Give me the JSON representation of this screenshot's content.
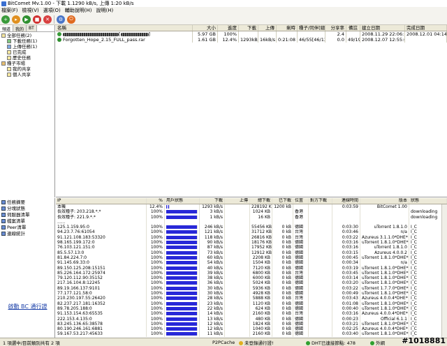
{
  "window": {
    "title": "BitComet Mv.1.00 - 下載 1.1290 kB/s, 上傳 1:20 kB/s"
  },
  "menu": [
    "檔案(F)",
    "檢視(V)",
    "選項(O)",
    "輔助說明(H)",
    "說明(H)"
  ],
  "left_tabs": [
    "頻道",
    "我的",
    "BT"
  ],
  "tree": [
    "全部任務(2)",
    "下載任務(1)",
    "上傳任務(1)",
    "已完成",
    "歷史任務",
    "種子市場",
    "我的共享",
    "個人共享"
  ],
  "file_columns": [
    "名稱",
    "大小",
    "進度",
    "下載",
    "上傳",
    "剩時",
    "種子/同伴[總]",
    "分享率",
    "備註",
    "建立日期",
    "完成日期"
  ],
  "files": [
    {
      "name": "[",
      "name_tail": "]",
      "size": "5.97 GB",
      "progress": "100%",
      "dl": "",
      "ul": "",
      "time": "",
      "seeds": "",
      "ratio": "2.4",
      "note": "",
      "created": "2008.11.29 22:06:13",
      "done": "2008.12.01 04:14:35"
    },
    {
      "name": "Forgotten_Hope_2.15_FULL_pass.rar",
      "name_tail": "",
      "size": "1.61 GB",
      "progress": "12.4%",
      "dl": "1293kB/s",
      "ul": "16kB/s",
      "time": "0:21:08",
      "seeds": "46/55[46/136]",
      "ratio": "0.0",
      "note": "49/19%",
      "created": "2008.12.07 12:55:05",
      "done": ""
    }
  ],
  "task_tabs": [
    "任務摘要",
    "分塊狀態",
    "伺服器清單",
    "檔案清單",
    "Peer清單",
    "連線統計"
  ],
  "ad_link": "啟動 BC 通行證",
  "peer_columns": [
    "IP",
    "%",
    "用戶狀態",
    "下載",
    "上傳",
    "總下載",
    "已下載",
    "位置",
    "對方下載",
    "連線時間",
    "版本",
    "狀態"
  ],
  "peers": [
    {
      "ip": "本機",
      "pct": "12.4%",
      "fill": 0.12,
      "dl": "1293 kB/s",
      "ul": "",
      "tot": "228192 KB",
      "dld": "1200 kB",
      "loc": "",
      "peerdl": "",
      "time": "0:03:59",
      "ver": "BitComet 1.00",
      "st": ""
    },
    {
      "ip": "長效種子: 203.218.*.*",
      "pct": "100%",
      "fill": 1,
      "dl": "3 kB/s",
      "ul": "",
      "tot": "1024 KB",
      "dld": "",
      "loc": "香港",
      "peerdl": "",
      "time": "",
      "ver": "",
      "st": "downloading"
    },
    {
      "ip": "長效種子: 221.9.*.*",
      "pct": "100%",
      "fill": 1,
      "dl": "1 kB/s",
      "ul": "",
      "tot": "16 KB",
      "dld": "",
      "loc": "香港",
      "peerdl": "",
      "time": "",
      "ver": "",
      "st": "downloading"
    },
    {
      "ip": "......",
      "pct": "",
      "fill": 0,
      "dl": "",
      "ul": "",
      "tot": "",
      "dld": "",
      "loc": "",
      "peerdl": "",
      "time": "",
      "ver": "",
      "st": ""
    },
    {
      "ip": "125.1.159.95:0",
      "pct": "100%",
      "fill": 1,
      "dl": "246 kB/s",
      "ul": "",
      "tot": "55456 KB",
      "dld": "0 kB",
      "loc": "德國",
      "peerdl": "",
      "time": "0:03:30",
      "ver": "uTorrent 1.8.1.0",
      "st": "I_C"
    },
    {
      "ip": "94.23.7.76:61054",
      "pct": "100%",
      "fill": 1,
      "dl": "121 kB/s",
      "ul": "",
      "tot": "31712 KB",
      "dld": "0 kB",
      "loc": "台灣",
      "peerdl": "",
      "time": "0:03:46",
      "ver": "n/a",
      "st": "I_C"
    },
    {
      "ip": "91.121.108.183:53320",
      "pct": "100%",
      "fill": 1,
      "dl": "118 kB/s",
      "ul": "",
      "tot": "26816 KB",
      "dld": "0 kB",
      "loc": "台灣",
      "peerdl": "",
      "time": "0:03:22",
      "ver": "Azureus 3.1.1.0*DHE*",
      "st": "I_C"
    },
    {
      "ip": "98.165.199.172:0",
      "pct": "100%",
      "fill": 1,
      "dl": "90 kB/s",
      "ul": "",
      "tot": "18176 KB",
      "dld": "0 kB",
      "loc": "德國",
      "peerdl": "",
      "time": "0:03:16",
      "ver": "uTorrent 1.8.1.0*DHE*",
      "st": "I_C"
    },
    {
      "ip": "76.103.121.151:0",
      "pct": "100%",
      "fill": 1,
      "dl": "87 kB/s",
      "ul": "",
      "tot": "17952 KB",
      "dld": "0 kB",
      "loc": "德國",
      "peerdl": "",
      "time": "0:03:16",
      "ver": "uTorrent 1.8.1.0",
      "st": "I_C"
    },
    {
      "ip": "85.5.57.13:0",
      "pct": "100%",
      "fill": 1,
      "dl": "73 kB/s",
      "ul": "",
      "tot": "12912 KB",
      "dld": "0 kB",
      "loc": "德國",
      "peerdl": "",
      "time": "0:03:15",
      "ver": "Azureus 4.0.0.2",
      "st": "I_C"
    },
    {
      "ip": "81.84.224.7:0",
      "pct": "100%",
      "fill": 1,
      "dl": "60 kB/s",
      "ul": "",
      "tot": "2208 KB",
      "dld": "0 kB",
      "loc": "德國",
      "peerdl": "",
      "time": "0:00:45",
      "ver": "uTorrent 1.8.1.0*DHE*",
      "st": "I_C"
    },
    {
      "ip": "91.145.69.33:0",
      "pct": "100%",
      "fill": 1,
      "dl": "54 kB/s",
      "ul": "",
      "tot": "1504 KB",
      "dld": "0 kB",
      "loc": "德國",
      "peerdl": "",
      "time": "0:00:34",
      "ver": "n/a",
      "st": "I_C"
    },
    {
      "ip": "89.150.125.208:15151",
      "pct": "100%",
      "fill": 1,
      "dl": "40 kB/s",
      "ul": "",
      "tot": "7120 KB",
      "dld": "0 kB",
      "loc": "德國",
      "peerdl": "",
      "time": "0:03:19",
      "ver": "uTorrent 1.8.1.0*DHE*",
      "st": "I_C"
    },
    {
      "ip": "85.226.164.172:25974",
      "pct": "100%",
      "fill": 1,
      "dl": "39 kB/s",
      "ul": "",
      "tot": "6800 KB",
      "dld": "0 kB",
      "loc": "台灣",
      "peerdl": "",
      "time": "0:03:45",
      "ver": "uTorrent 1.8.1.0*DHE*",
      "st": "I_C"
    },
    {
      "ip": "79.120.112.90:35152",
      "pct": "100%",
      "fill": 1,
      "dl": "38 kB/s",
      "ul": "",
      "tot": "6000 KB",
      "dld": "0 kB",
      "loc": "德國",
      "peerdl": "",
      "time": "0:03:14",
      "ver": "uTorrent 1.8.1.0*DHE*",
      "st": "I_C"
    },
    {
      "ip": "217.16.104.8:12245",
      "pct": "100%",
      "fill": 1,
      "dl": "36 kB/s",
      "ul": "",
      "tot": "5024 KB",
      "dld": "0 kB",
      "loc": "德國",
      "peerdl": "",
      "time": "0:03:20",
      "ver": "uTorrent 1.8.1.0*DHE*",
      "st": "I_C"
    },
    {
      "ip": "89.19.166.137:9101",
      "pct": "100%",
      "fill": 1,
      "dl": "30 kB/s",
      "ul": "",
      "tot": "5936 KB",
      "dld": "0 kB",
      "loc": "德國",
      "peerdl": "",
      "time": "0:03:22",
      "ver": "uTorrent 1.7.7.0*DHE*",
      "st": "I_C"
    },
    {
      "ip": "77.177.121.58:0",
      "pct": "100%",
      "fill": 1,
      "dl": "30 kB/s",
      "ul": "",
      "tot": "4928 KB",
      "dld": "0 kB",
      "loc": "德國",
      "peerdl": "",
      "time": "0:00:49",
      "ver": "uTorrent 1.8.1.0*DHE*",
      "st": "I_C"
    },
    {
      "ip": "210.230.197.55:26420",
      "pct": "100%",
      "fill": 1,
      "dl": "28 kB/s",
      "ul": "",
      "tot": "5888 KB",
      "dld": "0 kB",
      "loc": "台灣",
      "peerdl": "",
      "time": "0:03:43",
      "ver": "Azureus 4.0.0.4*DHE*",
      "st": "I_C"
    },
    {
      "ip": "82.237.217.181:16352",
      "pct": "100%",
      "fill": 1,
      "dl": "23 kB/s",
      "ul": "",
      "tot": "1120 KB",
      "dld": "0 kB",
      "loc": "德國",
      "peerdl": "",
      "time": "0:01:08",
      "ver": "uTorrent 1.8.1.0*DHE*",
      "st": "I_C"
    },
    {
      "ip": "89.78.205.188:0",
      "pct": "100%",
      "fill": 1,
      "dl": "22 kB/s",
      "ul": "",
      "tot": "624 KB",
      "dld": "0 kB",
      "loc": "德國",
      "peerdl": "",
      "time": "0:00:40",
      "ver": "uTorrent 1.8.1.0*DHE*",
      "st": "I_C"
    },
    {
      "ip": "91.153.154.63:65535",
      "pct": "100%",
      "fill": 1,
      "dl": "14 kB/s",
      "ul": "",
      "tot": "2160 KB",
      "dld": "0 kB",
      "loc": "台灣",
      "peerdl": "",
      "time": "0:03:16",
      "ver": "Azureus 4.0.0.4*DHE*",
      "st": "I_C"
    },
    {
      "ip": "222.153.4.135:0",
      "pct": "100%",
      "fill": 1,
      "dl": "13 kB/s",
      "ul": "",
      "tot": "480 KB",
      "dld": "0 kB",
      "loc": "德國",
      "peerdl": "",
      "time": "0:00:23",
      "ver": "Official 6.1.1",
      "st": "I_C"
    },
    {
      "ip": "83.245.136.65:38578",
      "pct": "100%",
      "fill": 1,
      "dl": "12 kB/s",
      "ul": "",
      "tot": "1824 KB",
      "dld": "0 kB",
      "loc": "德國",
      "peerdl": "",
      "time": "0:03:21",
      "ver": "uTorrent 1.8.1.0*DHE*",
      "st": "I_C"
    },
    {
      "ip": "80.190.246.161:6881",
      "pct": "100%",
      "fill": 1,
      "dl": "12 kB/s",
      "ul": "",
      "tot": "1040 KB",
      "dld": "0 kB",
      "loc": "德國",
      "peerdl": "",
      "time": "0:02:25",
      "ver": "Azureus 4.0.0.4*DHE*",
      "st": "I_C"
    },
    {
      "ip": "59.167.53.217:45633",
      "pct": "100%",
      "fill": 1,
      "dl": "11 kB/s",
      "ul": "",
      "tot": "2160 KB",
      "dld": "0 kB",
      "loc": "德國",
      "peerdl": "",
      "time": "0:03:40",
      "ver": "uTorrent 1.8.1.0*DHE*",
      "st": "I_C"
    }
  ],
  "status": {
    "left": "1 項選中/目前類別共有 2 項",
    "cache": "P2PCache",
    "login": "未登錄通行證!",
    "dht": "DHT已連接節點: 478",
    "ext": "外網",
    "watermark": "#1018881"
  }
}
